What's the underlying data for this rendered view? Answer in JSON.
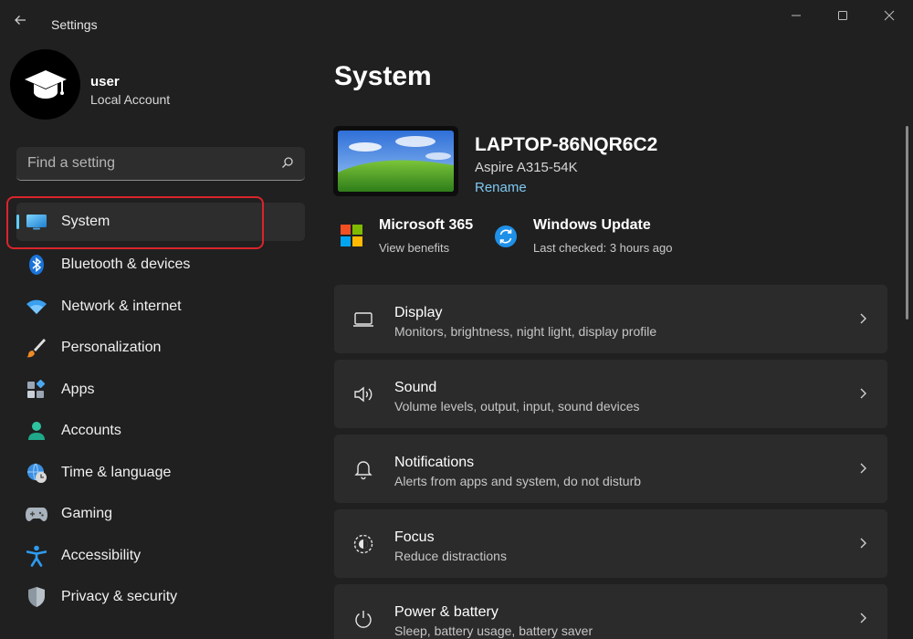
{
  "window": {
    "title": "Settings",
    "controls": {
      "minimize": "minimize-icon",
      "maximize": "maximize-icon",
      "close": "close-icon"
    }
  },
  "user": {
    "name": "user",
    "account_type": "Local Account",
    "avatar_icon": "graduation-cap-icon"
  },
  "search": {
    "placeholder": "Find a setting",
    "value": ""
  },
  "sidebar": {
    "items": [
      {
        "label": "System",
        "icon": "monitor-icon",
        "active": true
      },
      {
        "label": "Bluetooth & devices",
        "icon": "bluetooth-icon"
      },
      {
        "label": "Network & internet",
        "icon": "wifi-icon"
      },
      {
        "label": "Personalization",
        "icon": "brush-icon"
      },
      {
        "label": "Apps",
        "icon": "apps-icon"
      },
      {
        "label": "Accounts",
        "icon": "person-icon"
      },
      {
        "label": "Time & language",
        "icon": "globe-clock-icon"
      },
      {
        "label": "Gaming",
        "icon": "gamepad-icon"
      },
      {
        "label": "Accessibility",
        "icon": "accessibility-icon"
      },
      {
        "label": "Privacy & security",
        "icon": "shield-icon"
      }
    ]
  },
  "main": {
    "title": "System",
    "device": {
      "name": "LAPTOP-86NQR6C2",
      "model": "Aspire A315-54K",
      "rename_label": "Rename"
    },
    "quick_links": [
      {
        "title": "Microsoft 365",
        "subtitle": "View benefits",
        "icon": "microsoft-logo-icon"
      },
      {
        "title": "Windows Update",
        "subtitle": "Last checked: 3 hours ago",
        "icon": "windows-update-icon"
      }
    ],
    "cards": [
      {
        "title": "Display",
        "subtitle": "Monitors, brightness, night light, display profile",
        "icon": "display-icon"
      },
      {
        "title": "Sound",
        "subtitle": "Volume levels, output, input, sound devices",
        "icon": "speaker-icon"
      },
      {
        "title": "Notifications",
        "subtitle": "Alerts from apps and system, do not disturb",
        "icon": "bell-icon"
      },
      {
        "title": "Focus",
        "subtitle": "Reduce distractions",
        "icon": "focus-icon"
      },
      {
        "title": "Power & battery",
        "subtitle": "Sleep, battery usage, battery saver",
        "icon": "power-icon"
      }
    ]
  },
  "colors": {
    "accent": "#60cdff",
    "highlight": "#d9252b",
    "background": "#202020",
    "card": "#2b2b2b"
  }
}
